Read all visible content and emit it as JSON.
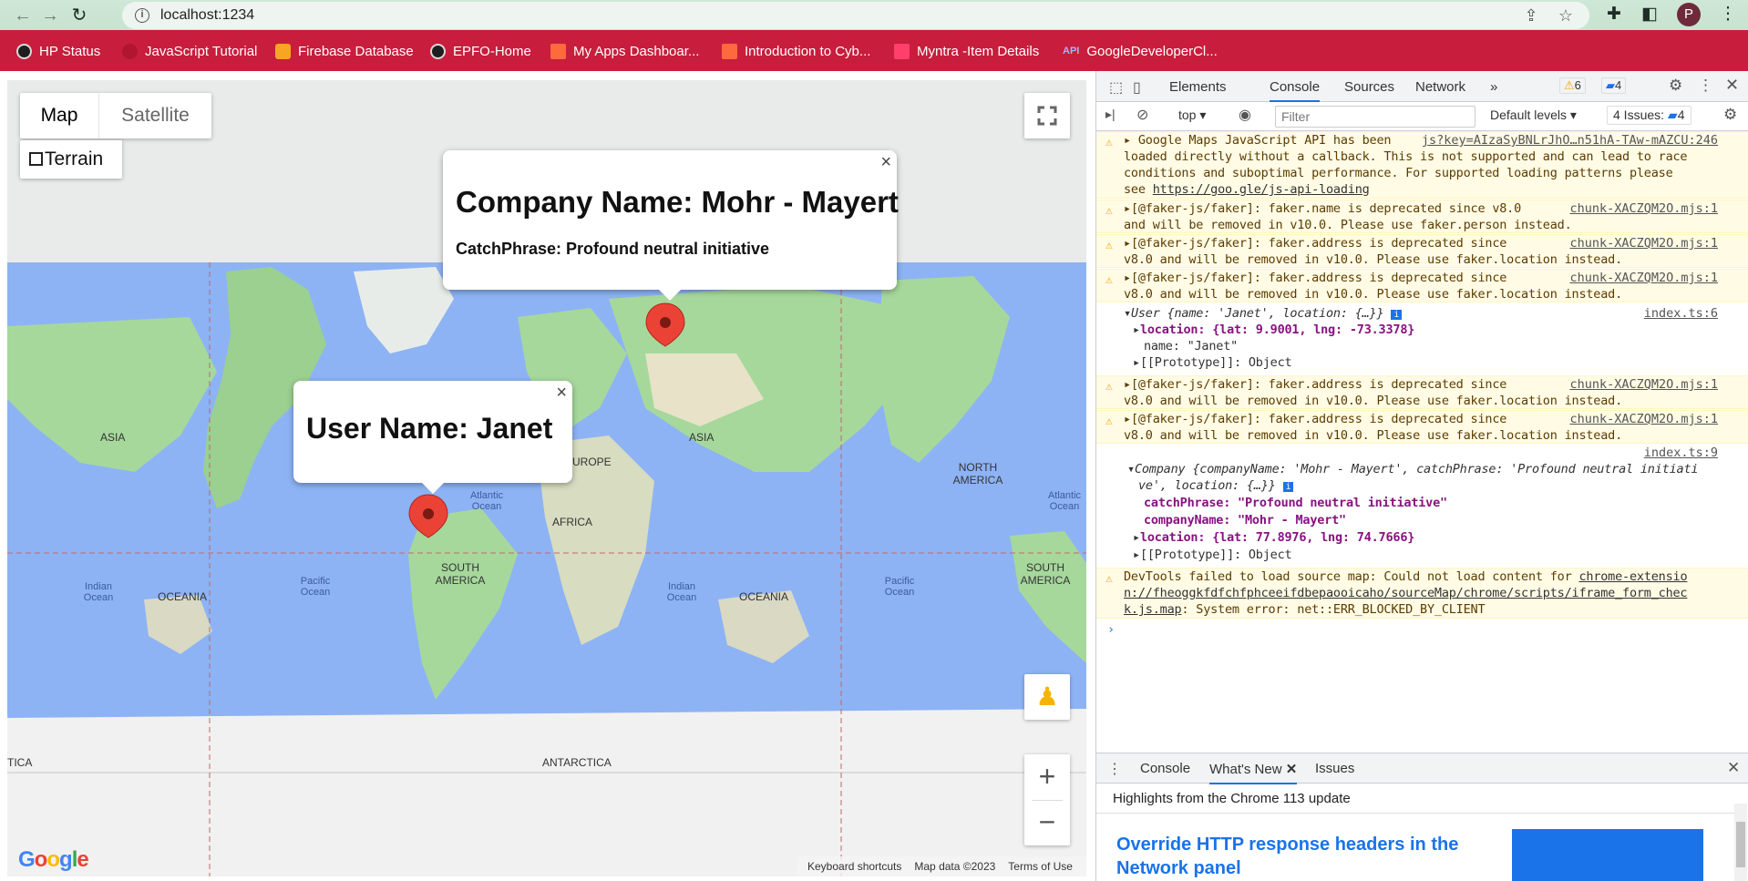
{
  "browser": {
    "url": "localhost:1234",
    "bookmarks": [
      {
        "label": "HP Status",
        "color": "#1e1e1e"
      },
      {
        "label": "JavaScript Tutorial",
        "color": "#c81d3c"
      },
      {
        "label": "Firebase Database",
        "color": "#f6a623"
      },
      {
        "label": "EPFO-Home",
        "color": "#1e1e1e"
      },
      {
        "label": "My Apps Dashboar...",
        "color": "#ff6a3d"
      },
      {
        "label": "Introduction to Cyb...",
        "color": "#ff6a3d"
      },
      {
        "label": "Myntra -Item Details",
        "color": "#ff3f6c"
      },
      {
        "label": "GoogleDeveloperCl...",
        "color": "#4f76e8"
      }
    ],
    "bookmark_api_badge": "API",
    "avatar_letter": "P"
  },
  "map": {
    "type_map": "Map",
    "type_satellite": "Satellite",
    "terrain": "Terrain",
    "company_popup": {
      "title": "Company Name: Mohr - Mayert",
      "catchphrase": "CatchPhrase: Profound neutral initiative"
    },
    "user_popup": {
      "title": "User Name: Janet"
    },
    "labels": {
      "asia": "ASIA",
      "europe": "EUROPE",
      "africa": "AFRICA",
      "oceania": "OCEANIA",
      "north_america": "NORTH AMERICA",
      "south_america": "SOUTH AMERICA",
      "antarctica": "ANTARCTICA",
      "atlantic": "Atlantic Ocean",
      "pacific": "Pacific Ocean",
      "indian": "Indian Ocean",
      "tica": "TICA"
    },
    "footer": {
      "shortcuts": "Keyboard shortcuts",
      "mapdata": "Map data ©2023",
      "terms": "Terms of Use"
    },
    "logo": "Google"
  },
  "devtools": {
    "tabs": [
      "Elements",
      "Console",
      "Sources",
      "Network"
    ],
    "active_tab": "Console",
    "warn_count": "6",
    "info_count": "4",
    "context": "top",
    "filter_placeholder": "Filter",
    "levels": "Default levels",
    "issues": "4 Issues:",
    "issues_count": "4",
    "messages": {
      "m1_l1": "Google Maps JavaScript API has been",
      "m1_src": "js?key=AIzaSyBNLrJhO…n51hA-TAw-mAZCU:246",
      "m1_l2": "loaded directly without a callback. This is not supported and can lead to race",
      "m1_l3": "conditions and suboptimal performance. For supported loading patterns please",
      "m1_l4": "see",
      "m1_link": "https://goo.gle/js-api-loading",
      "m2_l1": "[@faker-js/faker]: faker.name is deprecated since v8.0",
      "m2_l2": "and will be removed in v10.0. Please use faker.person instead.",
      "m3_l1": "[@faker-js/faker]: faker.address is deprecated since",
      "m3_l2": "v8.0 and will be removed in v10.0. Please use faker.location instead.",
      "faker_src": "chunk-XACZQM2O.mjs:1",
      "user_head": "User {name: 'Janet', location: {…}}",
      "user_src": "index.ts:6",
      "user_loc": "location: {lat: 9.9001, lng: -73.3378}",
      "user_name": "name: \"Janet\"",
      "proto": "[[Prototype]]: Object",
      "company_src": "index.ts:9",
      "company_head1": "Company {companyName: 'Mohr - Mayert', catchPhrase: 'Profound neutral initiati",
      "company_head2": "ve', location: {…}}",
      "company_catch": "catchPhrase: \"Profound neutral initiative\"",
      "company_name": "companyName: \"Mohr - Mayert\"",
      "company_loc": "location: {lat: 77.8976, lng: 74.7666}",
      "err_l1": "DevTools failed to load source map: Could not load content for",
      "err_link1": "chrome-extensio",
      "err_l2": "n://fheoggkfdfchfphceeifdbepaooicaho/sourceMap/chrome/scripts/iframe_form_chec",
      "err_l3a": "k.js.map",
      "err_l3b": ": System error: net::ERR_BLOCKED_BY_CLIENT"
    },
    "drawer": {
      "tabs": [
        "Console",
        "What's New",
        "Issues"
      ],
      "active": "What's New",
      "highlights": "Highlights from the Chrome 113 update",
      "article_title": "Override HTTP response headers in the",
      "article_title2": "Network panel"
    }
  }
}
